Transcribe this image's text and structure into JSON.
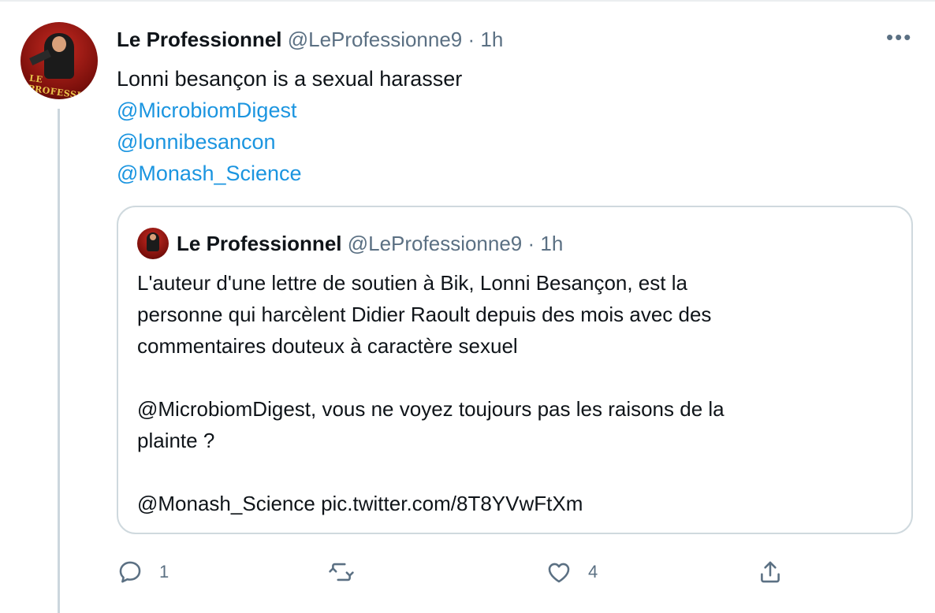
{
  "tweet": {
    "author_name": "Le Professionnel",
    "author_handle": "@LeProfessionne9",
    "separator": "·",
    "time": "1h",
    "more_label": "•••",
    "avatar_caption": "LE PROFESSIONNEL",
    "lines": [
      "Lonni besançon is a sexual harasser"
    ],
    "mentions": [
      "@MicrobiomDigest",
      "@lonnibesancon",
      "@Monash_Science"
    ]
  },
  "quote": {
    "author_name": "Le Professionnel",
    "author_handle": "@LeProfessionne9",
    "separator": "·",
    "time": "1h",
    "lines": [
      "L'auteur d'une lettre de soutien à Bik,  Lonni Besançon, est la",
      "personne qui harcèlent Didier Raoult depuis des mois avec des",
      "commentaires douteux à caractère sexuel",
      "",
      "@MicrobiomDigest, vous ne voyez toujours pas les raisons de la",
      "plainte ?",
      "",
      "@Monash_Science pic.twitter.com/8T8YVwFtXm"
    ]
  },
  "actions": {
    "reply_count": "1",
    "retweet_count": "",
    "like_count": "4",
    "icons": [
      "reply-icon",
      "retweet-icon",
      "like-icon",
      "share-icon"
    ]
  },
  "colors": {
    "link": "#1b95e0",
    "secondary": "#5b7083",
    "text": "#0f1419",
    "border": "#cfd9de"
  }
}
